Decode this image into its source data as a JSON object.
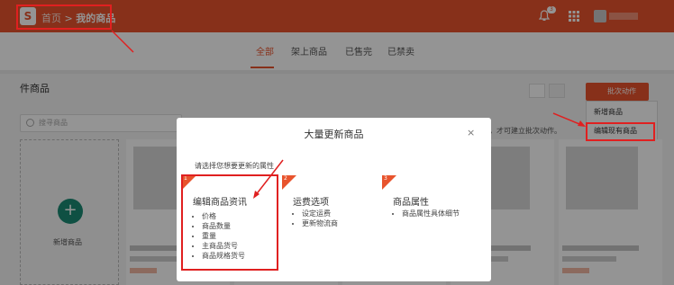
{
  "header": {
    "logo_letter": "S",
    "breadcrumb_home": "首页",
    "breadcrumb_sep": ">",
    "breadcrumb_current": "我的商品",
    "notification_count": "3"
  },
  "tabs": [
    {
      "label": "全部",
      "active": true
    },
    {
      "label": "架上商品",
      "active": false
    },
    {
      "label": "已售完",
      "active": false
    },
    {
      "label": "已禁卖",
      "active": false
    }
  ],
  "main": {
    "section_title": "件商品",
    "batch_button": "批次动作",
    "dropdown_items": [
      "新增商品",
      "编辑现有商品"
    ],
    "search_placeholder": "搜寻商品",
    "hint_text": "品，才可建立批次动作。",
    "add_product_label": "新增商品"
  },
  "modal": {
    "title": "大量更新商品",
    "close": "×",
    "prompt": "请选择您想要更新的属性",
    "options": [
      {
        "num": "1",
        "title": "编辑商品资讯",
        "items": [
          "价格",
          "商品数量",
          "重量",
          "主商品货号",
          "商品规格货号"
        ]
      },
      {
        "num": "2",
        "title": "运费选项",
        "items": [
          "设定运费",
          "更新物流商"
        ]
      },
      {
        "num": "3",
        "title": "商品属性",
        "items": [
          "商品属性具体细节"
        ]
      }
    ]
  },
  "colors": {
    "brand": "#e8542d",
    "highlight": "#e02020",
    "add_button": "#1b8b74"
  }
}
